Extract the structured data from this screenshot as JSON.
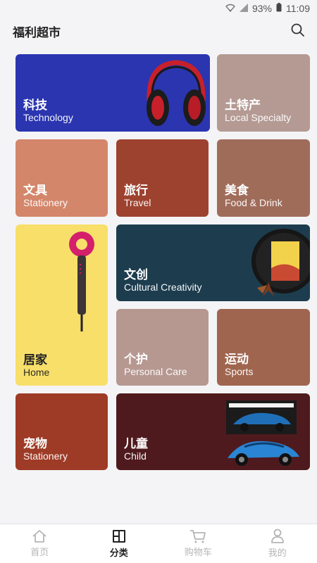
{
  "status_bar": {
    "battery": "93%",
    "time": "11:09"
  },
  "header": {
    "title": "福利超市"
  },
  "categories": [
    {
      "cn": "科技",
      "en": "Technology",
      "color": "#2b35b0"
    },
    {
      "cn": "土特产",
      "en": "Local Specialty",
      "color": "#b59a94"
    },
    {
      "cn": "文具",
      "en": "Stationery",
      "color": "#d4866a"
    },
    {
      "cn": "旅行",
      "en": "Travel",
      "color": "#9e4230"
    },
    {
      "cn": "美食",
      "en": "Food & Drink",
      "color": "#a06c5a"
    },
    {
      "cn": "居家",
      "en": "Home",
      "color": "#f7df6a"
    },
    {
      "cn": "文创",
      "en": "Cultural Creativity",
      "color": "#1d3d4f"
    },
    {
      "cn": "个护",
      "en": "Personal Care",
      "color": "#b69891"
    },
    {
      "cn": "运动",
      "en": "Sports",
      "color": "#a0654f"
    },
    {
      "cn": "宠物",
      "en": "Stationery",
      "color": "#9e3b26"
    },
    {
      "cn": "儿童",
      "en": "Child",
      "color": "#4f1a1e"
    }
  ],
  "tabs": [
    {
      "label": "首页",
      "icon": "home-icon",
      "active": false
    },
    {
      "label": "分类",
      "icon": "category-icon",
      "active": true
    },
    {
      "label": "购物车",
      "icon": "cart-icon",
      "active": false
    },
    {
      "label": "我的",
      "icon": "profile-icon",
      "active": false
    }
  ]
}
